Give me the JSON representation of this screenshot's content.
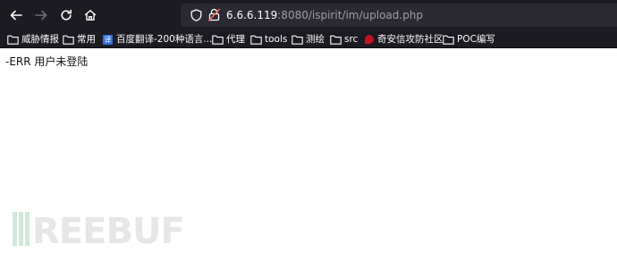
{
  "browser": {
    "nav": {
      "back": "back-icon",
      "forward": "forward-icon",
      "reload": "reload-icon",
      "home": "home-icon"
    },
    "url": {
      "host": "6.6.6.119",
      "rest": ":8080/ispirit/im/upload.php"
    },
    "icons": {
      "shield": "shield-icon",
      "insecure": "insecure-lock-icon"
    }
  },
  "bookmarks": [
    {
      "label": "威胁情报",
      "icon": "folder-icon"
    },
    {
      "label": "常用",
      "icon": "folder-icon"
    },
    {
      "label": "百度翻译-200种语言...",
      "icon": "translate-favicon",
      "favicon_text": "译"
    },
    {
      "label": "代理",
      "icon": "folder-icon"
    },
    {
      "label": "tools",
      "icon": "folder-icon"
    },
    {
      "label": "测绘",
      "icon": "folder-icon"
    },
    {
      "label": "src",
      "icon": "folder-icon"
    },
    {
      "label": "奇安信攻防社区",
      "icon": "qianxin-favicon"
    },
    {
      "label": "POC编写",
      "icon": "folder-icon"
    }
  ],
  "page": {
    "message": "-ERR 用户未登陆"
  },
  "watermark": {
    "text": "FREEBUF"
  },
  "colors": {
    "chrome": "#1c1b22",
    "urlbar": "#2b2a33",
    "watermark": "#c9e4d4"
  }
}
